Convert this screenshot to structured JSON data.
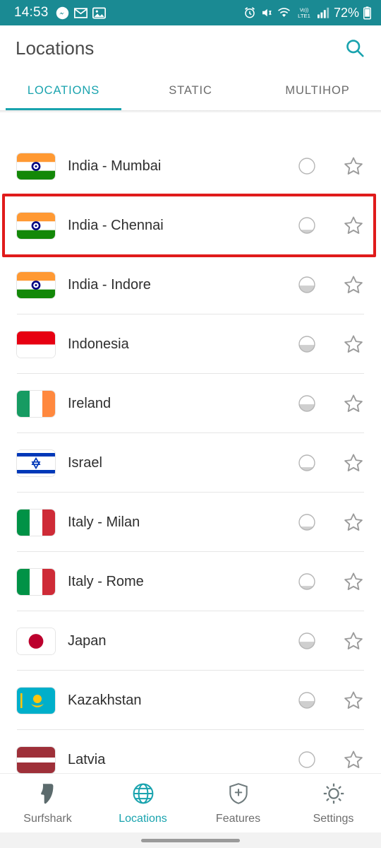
{
  "status_bar": {
    "time": "14:53",
    "battery_text": "72%",
    "network_text": "LTE1",
    "volte_text": "VoLTE",
    "left_icons": [
      "messenger-icon",
      "gmail-icon",
      "photos-icon"
    ],
    "right_icons": [
      "alarm-icon",
      "mute-vibrate-icon",
      "wifi-icon",
      "volte-lte-icon",
      "signal-bars-icon",
      "battery-icon"
    ],
    "background_color": "#1a8a93"
  },
  "header": {
    "title": "Locations",
    "search_icon": "search-icon"
  },
  "tabs": {
    "accent_color": "#19a3ae",
    "items": [
      {
        "label": "LOCATIONS",
        "active": true
      },
      {
        "label": "STATIC",
        "active": false
      },
      {
        "label": "MULTIHOP",
        "active": false
      }
    ]
  },
  "annotation": {
    "color": "#e01b1b",
    "target_label": "India - Chennai"
  },
  "list": {
    "rows": [
      {
        "label": "India - Mumbai",
        "flag": "flag-india",
        "load": "empty",
        "favorite": false
      },
      {
        "label": "India - Chennai",
        "flag": "flag-india",
        "load": "low",
        "favorite": false,
        "highlighted": true
      },
      {
        "label": "India - Indore",
        "flag": "flag-india",
        "load": "half",
        "favorite": false
      },
      {
        "label": "Indonesia",
        "flag": "flag-indonesia",
        "load": "half",
        "favorite": false
      },
      {
        "label": "Ireland",
        "flag": "flag-ireland",
        "load": "half",
        "favorite": false
      },
      {
        "label": "Israel",
        "flag": "flag-israel",
        "load": "low",
        "favorite": false
      },
      {
        "label": "Italy - Milan",
        "flag": "flag-italy",
        "load": "low",
        "favorite": false
      },
      {
        "label": "Italy - Rome",
        "flag": "flag-italy",
        "load": "low",
        "favorite": false
      },
      {
        "label": "Japan",
        "flag": "flag-japan",
        "load": "half",
        "favorite": false
      },
      {
        "label": "Kazakhstan",
        "flag": "flag-kazakhstan",
        "load": "half",
        "favorite": false
      },
      {
        "label": "Latvia",
        "flag": "flag-latvia",
        "load": "empty",
        "favorite": false
      }
    ]
  },
  "bottom_nav": {
    "active_color": "#19a3ae",
    "items": [
      {
        "label": "Surfshark",
        "icon": "surfshark-logo-icon",
        "active": false
      },
      {
        "label": "Locations",
        "icon": "globe-icon",
        "active": true
      },
      {
        "label": "Features",
        "icon": "shield-plus-icon",
        "active": false
      },
      {
        "label": "Settings",
        "icon": "gear-icon",
        "active": false
      }
    ]
  }
}
